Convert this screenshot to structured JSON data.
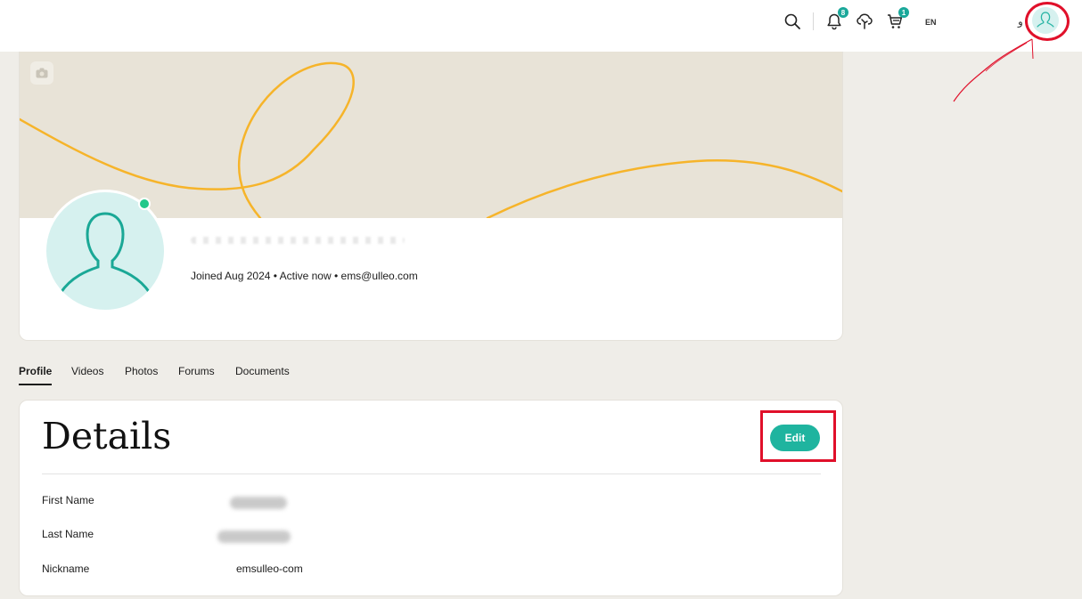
{
  "header": {
    "notifications_count": "8",
    "cart_count": "1",
    "language_label": "EN",
    "language_side_text": "و"
  },
  "profile": {
    "meta_line": "Joined Aug 2024 • Active now • ems@ulleo.com",
    "status": "online"
  },
  "tabs": [
    {
      "label": "Profile",
      "active": true
    },
    {
      "label": "Videos",
      "active": false
    },
    {
      "label": "Photos",
      "active": false
    },
    {
      "label": "Forums",
      "active": false
    },
    {
      "label": "Documents",
      "active": false
    }
  ],
  "details": {
    "title": "Details",
    "edit_label": "Edit",
    "rows": [
      {
        "label": "First Name",
        "value": ""
      },
      {
        "label": "Last Name",
        "value": ""
      },
      {
        "label": "Nickname",
        "value": "emsulleo-com"
      }
    ]
  },
  "colors": {
    "accent": "#1fb49f",
    "cover_background": "#e8e3d7",
    "cover_line": "#f6b42a",
    "annotation_red": "#e0102a",
    "page_background": "#efede8"
  },
  "icons": [
    "search-icon",
    "bell-icon",
    "tree-icon",
    "cart-icon",
    "camera-icon",
    "user-avatar-icon"
  ]
}
